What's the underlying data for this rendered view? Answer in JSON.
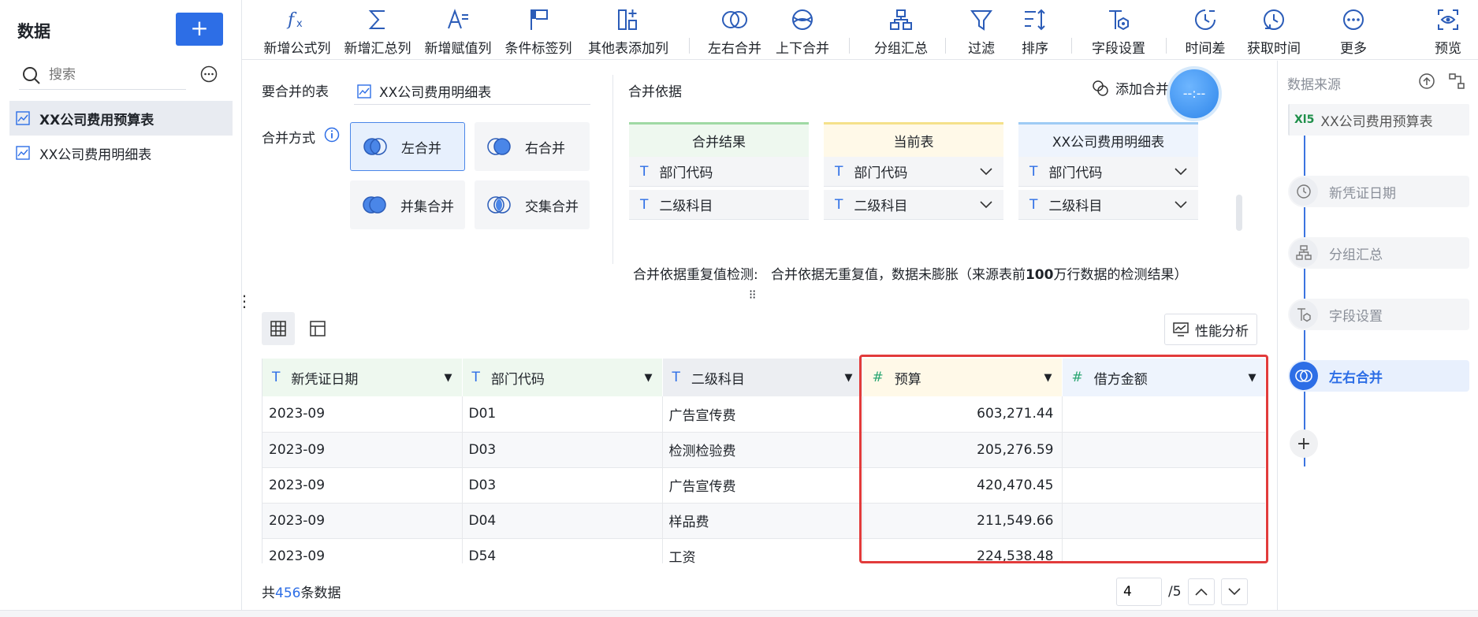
{
  "left": {
    "title": "数据",
    "add_label": "+",
    "search_placeholder": "搜索",
    "tables": [
      {
        "name": "XX公司费用预算表",
        "active": true
      },
      {
        "name": "XX公司费用明细表",
        "active": false
      }
    ]
  },
  "toolbar": {
    "tools": [
      {
        "label": "新增公式列",
        "icon": "fx-icon"
      },
      {
        "label": "新增汇总列",
        "icon": "sigma-icon"
      },
      {
        "label": "新增赋值列",
        "icon": "assign-icon"
      },
      {
        "label": "条件标签列",
        "icon": "flag-icon"
      },
      {
        "label": "其他表添加列",
        "icon": "add-column-icon"
      },
      {
        "label": "左右合并",
        "icon": "lr-merge-icon"
      },
      {
        "label": "上下合并",
        "icon": "ud-merge-icon"
      },
      {
        "label": "分组汇总",
        "icon": "group-icon"
      },
      {
        "label": "过滤",
        "icon": "filter-icon"
      },
      {
        "label": "排序",
        "icon": "sort-icon"
      },
      {
        "label": "字段设置",
        "icon": "field-settings-icon"
      },
      {
        "label": "时间差",
        "icon": "time-diff-icon"
      },
      {
        "label": "获取时间",
        "icon": "get-time-icon"
      },
      {
        "label": "更多",
        "icon": "more-icon"
      },
      {
        "label": "预览",
        "icon": "preview-icon"
      }
    ]
  },
  "config": {
    "merge_table_label": "要合并的表",
    "merge_table_value": "XX公司费用明细表",
    "merge_method_label": "合并方式",
    "methods": [
      {
        "label": "左合并",
        "selected": true
      },
      {
        "label": "右合并",
        "selected": false
      },
      {
        "label": "并集合并",
        "selected": false
      },
      {
        "label": "交集合并",
        "selected": false
      }
    ],
    "basis_label": "合并依据",
    "add_basis_label": "添加合并",
    "bubble_text": "--:--",
    "columns": [
      {
        "title": "合并结果",
        "color": "#9fd9a4",
        "bg": "#eef8ef",
        "fields": [
          "部门代码",
          "二级科目"
        ],
        "has_dropdown": false
      },
      {
        "title": "当前表",
        "color": "#f5e18a",
        "bg": "#fff9e8",
        "fields": [
          "部门代码",
          "二级科目"
        ],
        "has_dropdown": true
      },
      {
        "title": "XX公司费用明细表",
        "color": "#9ecbf5",
        "bg": "#eef4fd",
        "fields": [
          "部门代码",
          "二级科目"
        ],
        "has_dropdown": true
      }
    ],
    "detect_label": "合并依据重复值检测:",
    "detect_pre": "合并依据无重复值，数据未膨胀（来源表前",
    "detect_bold": "100",
    "detect_post": "万行数据的检测结果）"
  },
  "data": {
    "perf_label": "性能分析",
    "headers": [
      {
        "name": "新凭证日期",
        "type": "T",
        "cls": "th-t"
      },
      {
        "name": "部门代码",
        "type": "T",
        "cls": "th-t"
      },
      {
        "name": "二级科目",
        "type": "T",
        "cls": "th-x"
      },
      {
        "name": "预算",
        "type": "#",
        "cls": "th-n"
      },
      {
        "name": "借方金额",
        "type": "#",
        "cls": "th-n2"
      }
    ],
    "rows": [
      [
        "2023-09",
        "D01",
        "广告宣传费",
        "603,271.44",
        ""
      ],
      [
        "2023-09",
        "D03",
        "检测检验费",
        "205,276.59",
        ""
      ],
      [
        "2023-09",
        "D03",
        "广告宣传费",
        "420,470.45",
        ""
      ],
      [
        "2023-09",
        "D04",
        "样品费",
        "211,549.66",
        ""
      ],
      [
        "2023-09",
        "D54",
        "工资",
        "224,538.48",
        ""
      ]
    ],
    "total_pre": "共",
    "total_count": "456",
    "total_post": "条数据",
    "page_current": "4",
    "page_total": "/5"
  },
  "right": {
    "title": "数据来源",
    "source": {
      "badge": "Xl5",
      "name": "XX公司费用预算表"
    },
    "steps": [
      {
        "label": "新凭证日期",
        "icon": "clock-icon",
        "active": false
      },
      {
        "label": "分组汇总",
        "icon": "group-icon",
        "active": false
      },
      {
        "label": "字段设置",
        "icon": "field-settings-icon",
        "active": false
      },
      {
        "label": "左右合并",
        "icon": "lr-merge-icon",
        "active": true
      }
    ],
    "add_label": "+"
  },
  "colors": {
    "accent": "#2d6ee6",
    "highlight": "#e23b3b"
  }
}
